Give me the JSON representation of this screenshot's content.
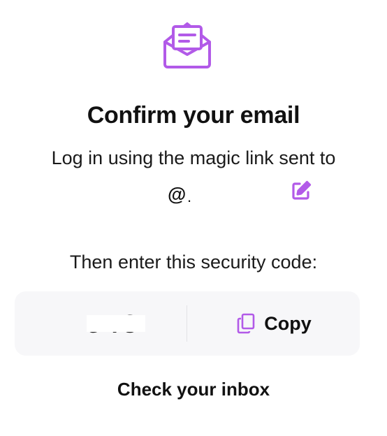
{
  "colors": {
    "accent": "#b25ae8",
    "box_bg": "#f7f7f9",
    "text": "#111111"
  },
  "icons": {
    "hero": "open-envelope-icon",
    "edit": "edit-icon",
    "copy": "copy-icon"
  },
  "title": "Confirm your email",
  "subtitle": "Log in using the magic link sent to",
  "email": {
    "prefix": "@",
    "suffix": "."
  },
  "instruction": "Then enter this security code:",
  "code": {
    "value": "548",
    "copy_label": "Copy"
  },
  "inbox_link": "Check your inbox"
}
